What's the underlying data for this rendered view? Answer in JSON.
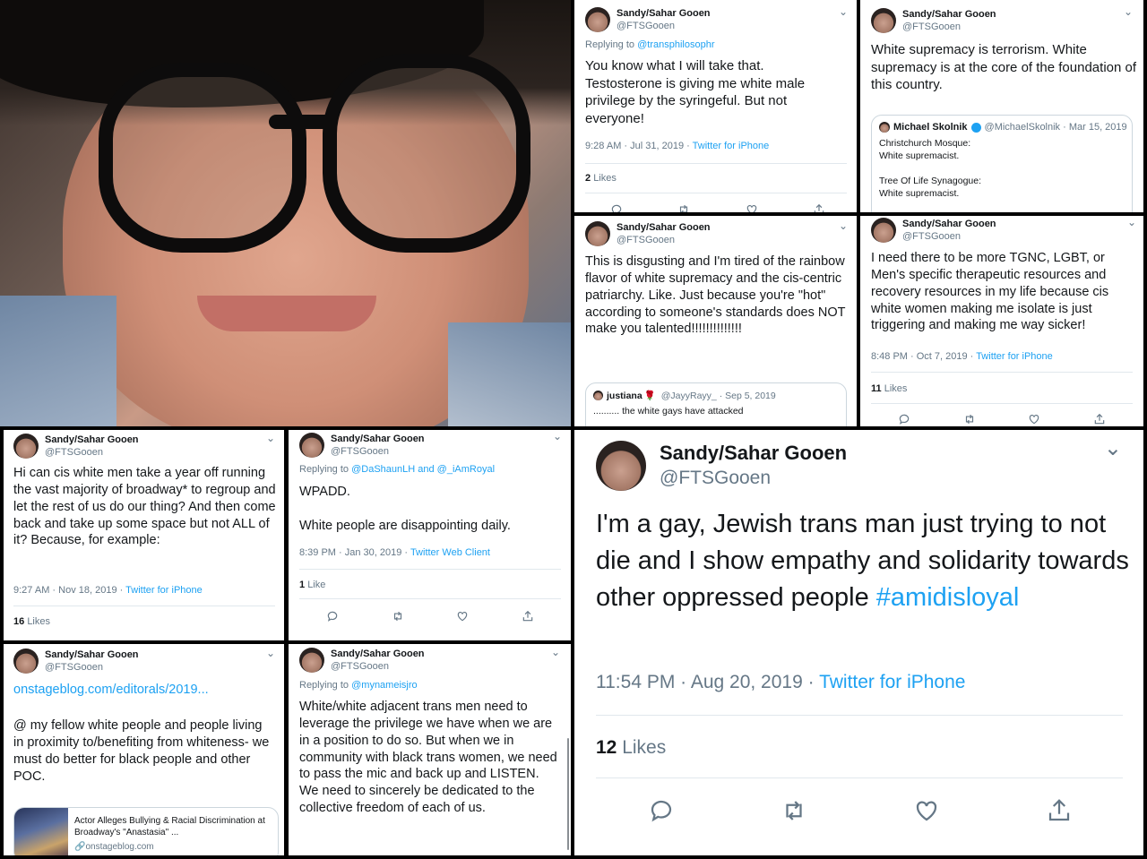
{
  "colors": {
    "accent": "#1da1f2",
    "text": "#14171a",
    "muted": "#657786",
    "divider": "#e1e8ed"
  },
  "author": {
    "name": "Sandy/Sahar Gooen",
    "handle": "@FTSGooen"
  },
  "t1": {
    "reply_label": "Replying to",
    "reply_to": "@transphilosophr",
    "text": "You know what I will take that.\nTestosterone is giving me white male privilege by the syringeful. But not everyone!",
    "time": "9:28 AM · Jul 31, 2019 · ",
    "client": "Twitter for iPhone",
    "likes_count": "2",
    "likes_label": "Likes"
  },
  "t2": {
    "text": "White supremacy is terrorism. White supremacy is at the core of the foundation of this country.",
    "quote": {
      "name": "Michael Skolnik",
      "handle": "@MichaelSkolnik · Mar 15, 2019",
      "text": "Christchurch Mosque:\nWhite supremacist.\n\nTree Of Life Synagogue:\nWhite supremacist."
    }
  },
  "t3": {
    "text": "This is disgusting and I'm tired of the rainbow flavor of white supremacy and the cis-centric patriarchy. Like. Just because you're \"hot\" according to someone's standards does NOT make you talented!!!!!!!!!!!!!!",
    "quote": {
      "name": "justiana",
      "handle": "@JayyRayy_ · Sep 5, 2019",
      "text": ".......... the white gays have attacked"
    }
  },
  "t4": {
    "text": "I need there to be more TGNC, LGBT, or Men's specific therapeutic resources and recovery resources in my life because cis white women making me isolate is just triggering and making me way sicker!",
    "time": "8:48 PM · Oct 7, 2019 · ",
    "client": "Twitter for iPhone",
    "likes_count": "11",
    "likes_label": "Likes"
  },
  "t5": {
    "text": "Hi can cis white men take a year off running the vast majority of broadway* to regroup and let the rest of us do our thing? And then come back and take up some space but not ALL of it? Because, for example:",
    "time": "9:27 AM · Nov 18, 2019 · ",
    "client": "Twitter for iPhone",
    "likes_count": "16",
    "likes_label": "Likes"
  },
  "t6": {
    "reply_label": "Replying to",
    "reply_to": "@DaShaunLH and @_iAmRoyal",
    "text": "WPADD.\n\nWhite people are disappointing daily.",
    "time": "8:39 PM · Jan 30, 2019 · ",
    "client": "Twitter Web Client",
    "likes_count": "1",
    "likes_label": "Like"
  },
  "t7": {
    "link": "onstageblog.com/editorals/2019...",
    "text": "@ my fellow white people and people living in proximity to/benefiting from whiteness- we must do better for black people and other POC.",
    "card": {
      "title": "Actor Alleges Bullying & Racial Discrimination at Broadway's \"Anastasia\" ...",
      "domain": "onstageblog.com"
    }
  },
  "t8": {
    "reply_label": "Replying to",
    "reply_to": "@mynameisjro",
    "text": "White/white adjacent trans men need to leverage the privilege we have when we are in a position to do so. But when we in community with black trans women, we need to pass the mic and back up and LISTEN. We need to sincerely be dedicated to the collective freedom of each of us."
  },
  "t9": {
    "text": "I'm a gay, Jewish trans man just trying to not die and I show empathy and solidarity towards other oppressed people",
    "hashtag": "#amidisloyal",
    "time": "11:54 PM · Aug 20, 2019 · ",
    "client": "Twitter for iPhone",
    "likes_count": "12",
    "likes_label": "Likes"
  },
  "icons": {
    "reply": "reply-icon",
    "retweet": "retweet-icon",
    "like": "heart-icon",
    "share": "share-icon",
    "chevron": "chevron-down-icon"
  }
}
